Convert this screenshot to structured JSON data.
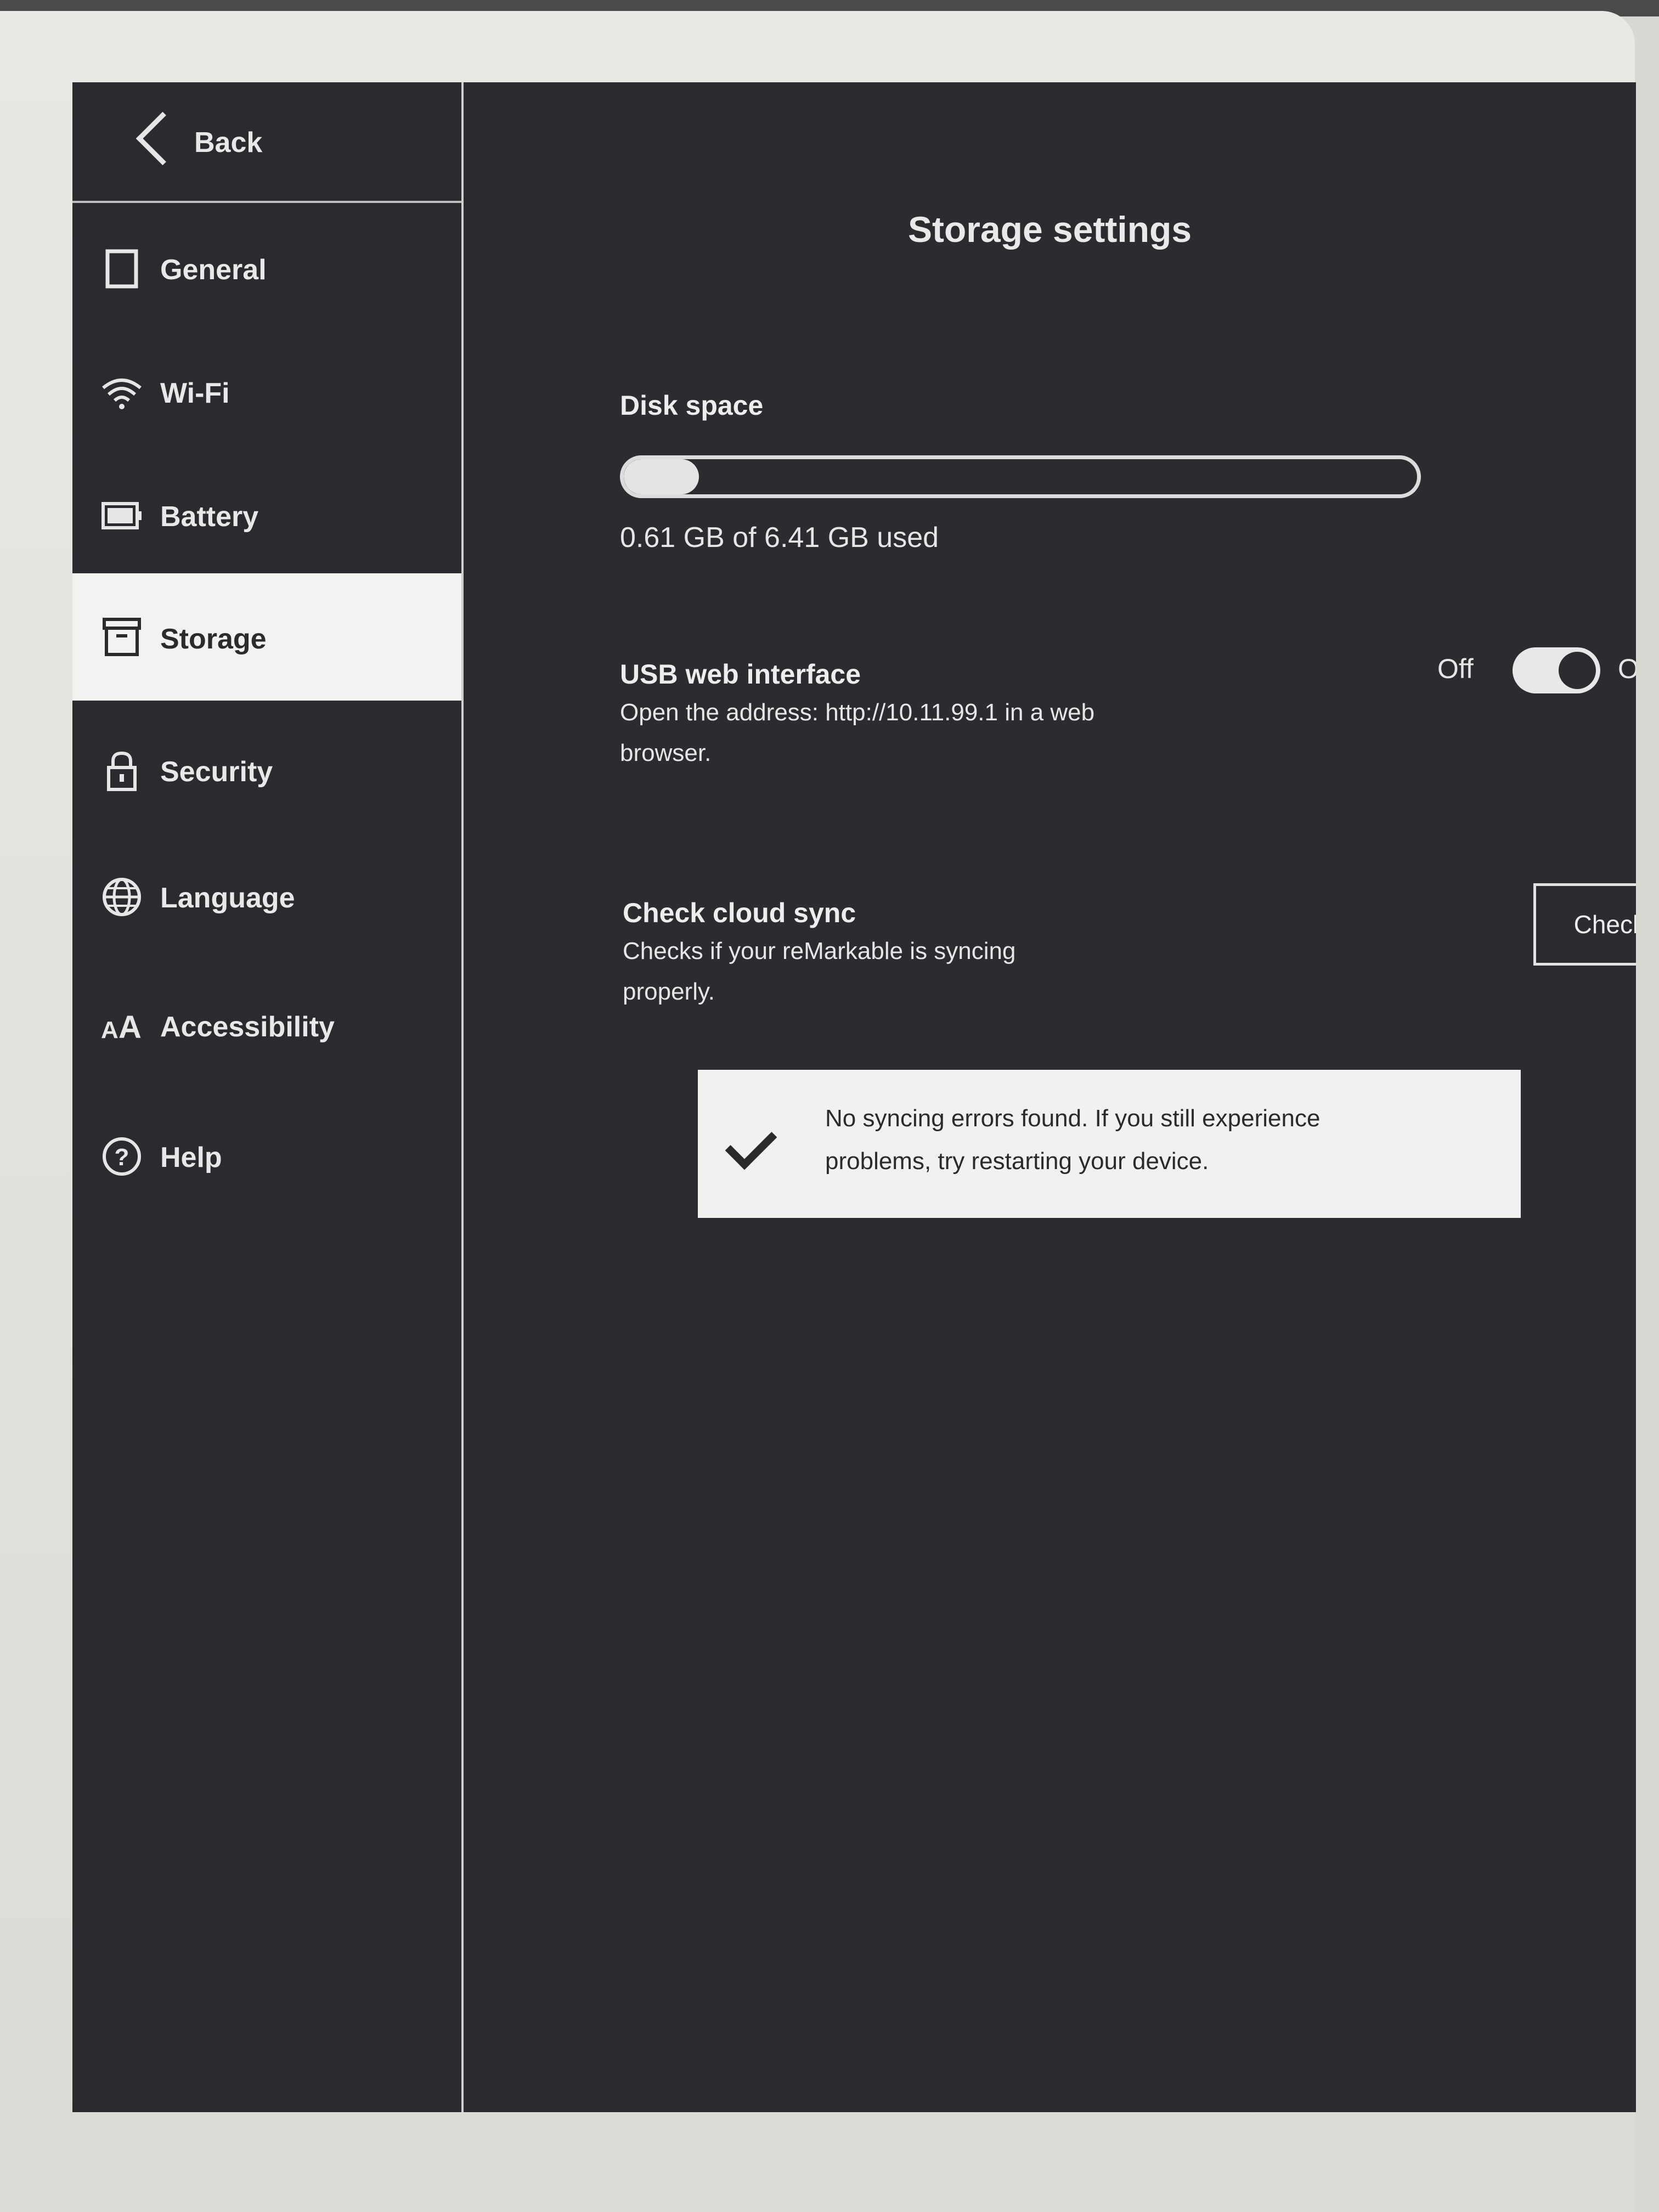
{
  "sidebar": {
    "back_label": "Back",
    "items": [
      {
        "label": "General",
        "icon": "square-icon"
      },
      {
        "label": "Wi-Fi",
        "icon": "wifi-icon"
      },
      {
        "label": "Battery",
        "icon": "battery-icon"
      },
      {
        "label": "Storage",
        "icon": "archive-icon",
        "selected": true
      },
      {
        "label": "Security",
        "icon": "lock-icon"
      },
      {
        "label": "Language",
        "icon": "globe-icon"
      },
      {
        "label": "Accessibility",
        "icon": "text-size-icon"
      },
      {
        "label": "Help",
        "icon": "help-icon"
      }
    ]
  },
  "main": {
    "title": "Storage settings",
    "disk": {
      "label": "Disk space",
      "used_fraction": 0.095,
      "usage_text": "0.61 GB of 6.41 GB used"
    },
    "usb": {
      "label": "USB web interface",
      "description_line1": "Open the address: http://10.11.99.1 in a web",
      "description_line2": "browser.",
      "toggle_off_label": "Off",
      "toggle_on_label": "On",
      "enabled": true
    },
    "cloud_sync": {
      "label": "Check cloud sync",
      "description_line1": "Checks if your reMarkable is syncing",
      "description_line2": "properly.",
      "button_label": "Check sync"
    },
    "notice": {
      "line1": "No syncing errors found. If you still experience",
      "line2": "problems, try restarting your device."
    }
  },
  "colors": {
    "screen_bg": "#2b2c2f",
    "text": "#e8e8e8",
    "selected_bg": "#f2f2f0"
  }
}
